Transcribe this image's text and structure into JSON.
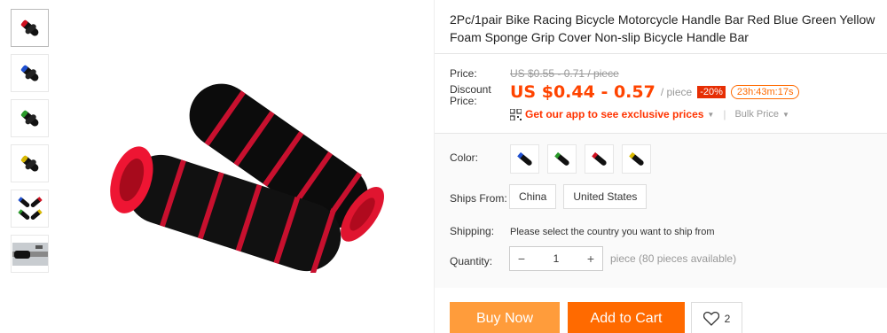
{
  "product": {
    "title": "2Pc/1pair Bike Racing Bicycle Motorcycle Handle Bar Red Blue Green Yellow Foam Sponge Grip Cover Non-slip Bicycle Handle Bar"
  },
  "gallery": {
    "thumbnails": [
      "red-grip",
      "blue-grip",
      "green-grip",
      "yellow-grip",
      "all-colors",
      "mounted-grip"
    ],
    "main_image": "red-foam-grip-pair"
  },
  "price": {
    "label": "Price:",
    "original": "US $0.55 - 0.71 / piece",
    "discount_label_1": "Discount",
    "discount_label_2": "Price:",
    "discount": "US $0.44 - 0.57",
    "per": "/ piece",
    "percent_off": "-20%",
    "countdown": "23h:43m:17s",
    "app_promo": "Get our app to see exclusive prices",
    "bulk": "Bulk Price",
    "accent_color": "#ff4400"
  },
  "sku": {
    "color_label": "Color:",
    "colors": [
      "blue",
      "green",
      "red",
      "yellow"
    ],
    "ships_from_label": "Ships From:",
    "ships_from": [
      "China",
      "United States"
    ],
    "shipping_label": "Shipping:",
    "shipping_msg": "Please select the country you want to ship from",
    "quantity_label": "Quantity:",
    "quantity_value": "1",
    "minus": "−",
    "plus": "+",
    "availability": "piece (80 pieces available)"
  },
  "actions": {
    "buy_now": "Buy Now",
    "add_to_cart": "Add to Cart",
    "wishlist_count": "2",
    "buy_color": "#ff9c3b",
    "cart_color": "#ff6a00"
  }
}
